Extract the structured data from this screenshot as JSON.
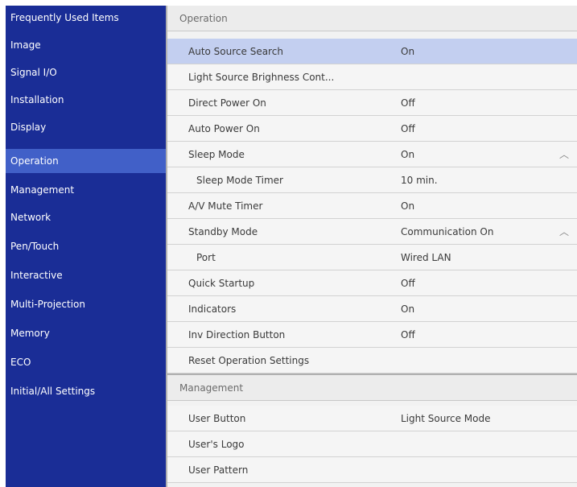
{
  "sidebar": {
    "items": [
      {
        "label": "Frequently Used Items"
      },
      {
        "label": "Image"
      },
      {
        "label": "Signal I/O"
      },
      {
        "label": "Installation"
      },
      {
        "label": "Display"
      },
      {
        "label": "Operation",
        "active": true
      },
      {
        "label": "Management"
      },
      {
        "label": "Network"
      },
      {
        "label": "Pen/Touch"
      },
      {
        "label": "Interactive"
      },
      {
        "label": "Multi-Projection"
      },
      {
        "label": "Memory"
      },
      {
        "label": "ECO"
      },
      {
        "label": "Initial/All Settings"
      }
    ]
  },
  "main": {
    "operation": {
      "header": "Operation",
      "rows": [
        {
          "label": "Auto Source Search",
          "value": "On",
          "selected": true
        },
        {
          "label": "Light Source Brighness Cont...",
          "value": ""
        },
        {
          "label": "Direct Power On",
          "value": "Off"
        },
        {
          "label": "Auto Power On",
          "value": "Off"
        },
        {
          "label": "Sleep Mode",
          "value": "On",
          "chevron": "chevron-up-icon"
        },
        {
          "label": "Sleep Mode Timer",
          "value": "10 min.",
          "sub": true
        },
        {
          "label": "A/V Mute Timer",
          "value": "On"
        },
        {
          "label": "Standby Mode",
          "value": "Communication On",
          "chevron": "chevron-up-icon"
        },
        {
          "label": "Port",
          "value": "Wired LAN",
          "sub": true
        },
        {
          "label": "Quick Startup",
          "value": "Off"
        },
        {
          "label": "Indicators",
          "value": "On"
        },
        {
          "label": "Inv Direction Button",
          "value": "Off"
        },
        {
          "label": "Reset Operation Settings",
          "value": ""
        }
      ]
    },
    "management": {
      "header": "Management",
      "rows": [
        {
          "label": "User Button",
          "value": "Light Source Mode"
        },
        {
          "label": "User's Logo",
          "value": ""
        },
        {
          "label": "User Pattern",
          "value": ""
        }
      ]
    }
  },
  "colors": {
    "sidebar_bg": "#1a2d96",
    "sidebar_active": "#4160c8",
    "row_selected": "#c3cff0"
  }
}
